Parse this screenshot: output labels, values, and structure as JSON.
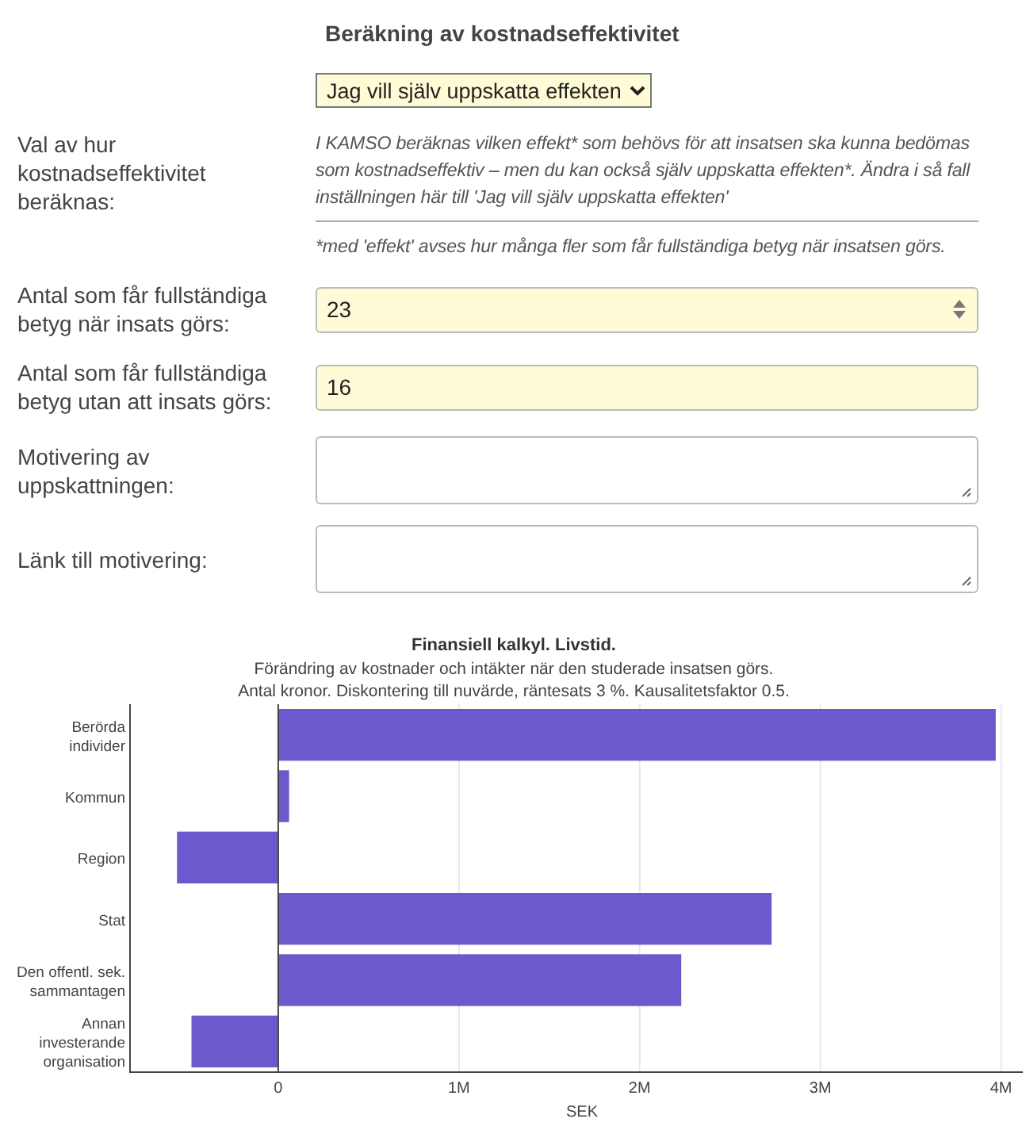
{
  "heading": "Beräkning av kostnadseffektivitet",
  "method_select": {
    "value": "Jag vill själv uppskatta effekten"
  },
  "method_row": {
    "label": "Val av hur kostnadseffektivitet beräknas:",
    "description": "I KAMSO beräknas vilken effekt* som behövs för att insatsen ska kunna bedömas som kostnadseffektiv – men du kan också själv uppskatta effekten*. Ändra i så fall inställningen här till 'Jag vill själv uppskatta effekten'",
    "footnote": "*med 'effekt' avses hur många fler som får fullständiga betyg när insatsen görs."
  },
  "fields": [
    {
      "kind": "number",
      "label": "Antal som får fullständiga betyg när insats görs:",
      "value": "23"
    },
    {
      "kind": "text",
      "label": "Antal som får fullständiga betyg utan att insats görs:",
      "value": "16"
    },
    {
      "kind": "textarea",
      "label": "Motivering av uppskattningen:"
    },
    {
      "kind": "textarea",
      "label": "Länk till motivering:"
    }
  ],
  "chart": {
    "chart_data": {
      "type": "bar",
      "orientation": "horizontal",
      "title": "Finansiell kalkyl. Livstid.",
      "subtitle": [
        "Förändring av kostnader och intäkter när den studerade insatsen görs.",
        "Antal kronor. Diskontering till nuvärde, räntesats 3 %. Kausalitetsfaktor 0.5."
      ],
      "xlabel": "SEK",
      "categories": [
        "Berörda\nindivider",
        "Kommun",
        "Region",
        "Stat",
        "Den offentl. sek.\nsammantagen",
        "Annan\ninvesterande\norganisation"
      ],
      "series": [
        {
          "color": "#6a5acd",
          "values": [
            3970000,
            60000,
            -560000,
            2730000,
            2230000,
            -480000
          ]
        }
      ],
      "xlim": [
        -820000,
        4120000
      ],
      "grid": true,
      "xticks": [
        {
          "value": 0,
          "label": "0"
        },
        {
          "value": 1000000,
          "label": "1M"
        },
        {
          "value": 2000000,
          "label": "2M"
        },
        {
          "value": 3000000,
          "label": "3M"
        },
        {
          "value": 4000000,
          "label": "4M"
        }
      ]
    }
  }
}
